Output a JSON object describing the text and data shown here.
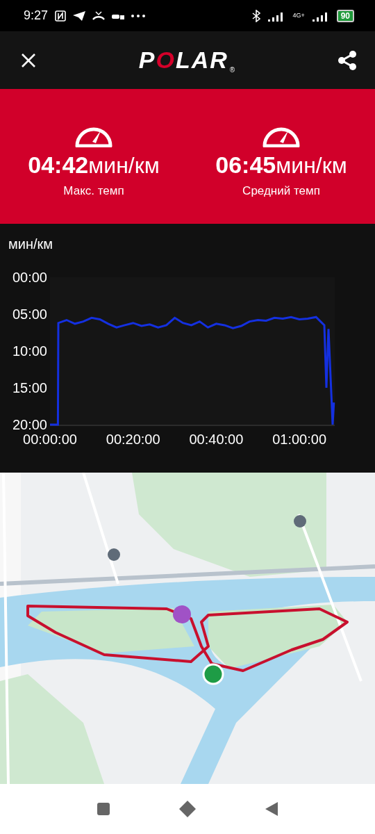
{
  "status_bar": {
    "time": "9:27",
    "network": "4G+",
    "battery": "90"
  },
  "header": {
    "logo": "POLAR",
    "logo_mark": "®"
  },
  "stats": [
    {
      "value": "04:42",
      "unit": "мин/км",
      "label": "Макс. темп"
    },
    {
      "value": "06:45",
      "unit": "мин/км",
      "label": "Средний темп"
    }
  ],
  "pace_chart": {
    "unit": "мин/км",
    "chart_data": {
      "type": "line",
      "x": [
        0,
        1.9,
        2,
        4,
        6,
        8,
        10,
        12,
        14,
        16,
        18,
        20,
        22,
        24,
        26,
        28,
        30,
        32,
        34,
        36,
        38,
        40,
        42,
        44,
        46,
        48,
        50,
        52,
        54,
        56,
        58,
        60,
        62,
        64,
        66,
        66.5,
        67,
        68,
        68.3
      ],
      "series": [
        {
          "color": "#1430e0",
          "values": [
            20,
            20,
            6.2,
            5.8,
            6.3,
            6.0,
            5.5,
            5.7,
            6.3,
            6.8,
            6.5,
            6.2,
            6.6,
            6.4,
            6.8,
            6.5,
            5.5,
            6.2,
            6.5,
            6.0,
            6.8,
            6.3,
            6.5,
            6.9,
            6.6,
            6.0,
            5.8,
            5.9,
            5.5,
            5.6,
            5.4,
            5.7,
            5.6,
            5.4,
            6.5,
            15,
            7,
            20,
            17
          ]
        }
      ],
      "xlim": [
        0,
        68.5
      ],
      "ylim": [
        20,
        0
      ],
      "xticks": [
        {
          "value": 0,
          "label": "00:00:00"
        },
        {
          "value": 20,
          "label": "00:20:00"
        },
        {
          "value": 40,
          "label": "00:40:00"
        },
        {
          "value": 60,
          "label": "01:00:00"
        }
      ],
      "yticks": [
        {
          "value": 0,
          "label": "00:00"
        },
        {
          "value": 5,
          "label": "05:00"
        },
        {
          "value": 10,
          "label": "10:00"
        },
        {
          "value": 15,
          "label": "15:00"
        },
        {
          "value": 20,
          "label": "20:00"
        }
      ]
    }
  }
}
